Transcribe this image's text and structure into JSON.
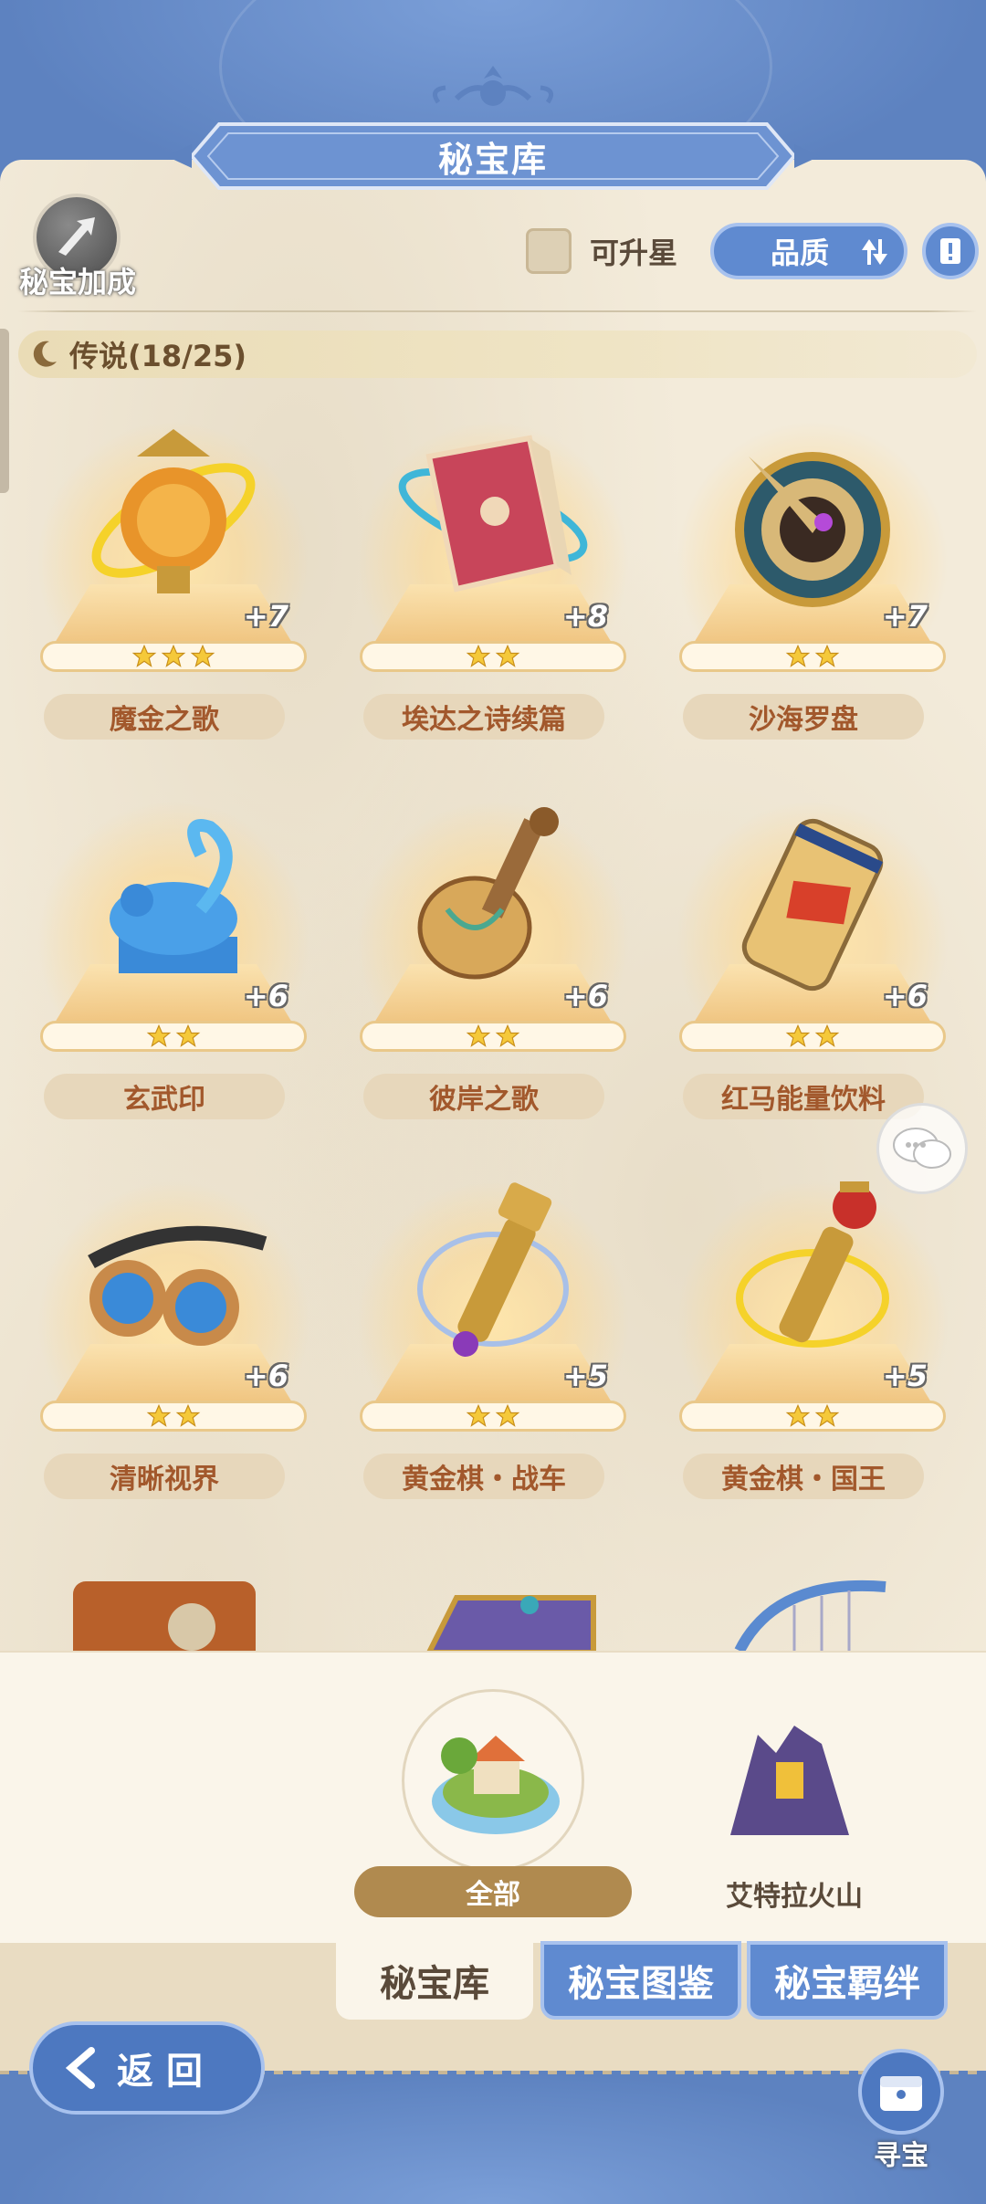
{
  "header": {
    "title": "秘宝库"
  },
  "bonus": {
    "label": "秘宝加成"
  },
  "controls": {
    "upgradable_label": "可升星",
    "sort_label": "品质"
  },
  "section": {
    "title": "传说(18/25)"
  },
  "items": [
    {
      "name": "魔金之歌",
      "plus": "+7",
      "stars": 3,
      "icon": "golden-orb-relic-icon"
    },
    {
      "name": "埃达之诗续篇",
      "plus": "+8",
      "stars": 2,
      "icon": "red-book-icon"
    },
    {
      "name": "沙海罗盘",
      "plus": "+7",
      "stars": 2,
      "icon": "compass-icon"
    },
    {
      "name": "玄武印",
      "plus": "+6",
      "stars": 2,
      "icon": "tortoise-seal-icon"
    },
    {
      "name": "彼岸之歌",
      "plus": "+6",
      "stars": 2,
      "icon": "lute-icon"
    },
    {
      "name": "红马能量饮料",
      "plus": "+6",
      "stars": 2,
      "icon": "energy-drink-can-icon"
    },
    {
      "name": "清晰视界",
      "plus": "+6",
      "stars": 2,
      "icon": "goggles-icon"
    },
    {
      "name": "黄金棋・战车",
      "plus": "+5",
      "stars": 2,
      "icon": "chess-rook-icon"
    },
    {
      "name": "黄金棋・国王",
      "plus": "+5",
      "stars": 2,
      "icon": "chess-king-icon"
    }
  ],
  "regions": {
    "all_label": "全部",
    "volcano_label": "艾特拉火山"
  },
  "tabs": {
    "tab1": "秘宝库",
    "tab2": "秘宝图鉴",
    "tab3": "秘宝羁绊"
  },
  "footer": {
    "back_label": "返回",
    "treasure_label": "寻宝"
  },
  "colors": {
    "accent_blue": "#5f8ad0",
    "parchment": "#f3ebda",
    "name_text": "#a2582c"
  }
}
